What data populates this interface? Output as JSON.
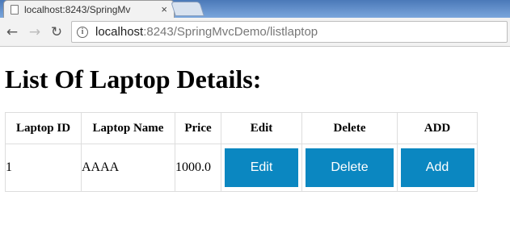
{
  "browser": {
    "tab_title": "localhost:8243/SpringMv",
    "tab_close": "×",
    "url_host": "localhost",
    "url_path": ":8243/SpringMvcDemo/listlaptop"
  },
  "page": {
    "title": "List Of Laptop Details:"
  },
  "table": {
    "headers": [
      "Laptop ID",
      "Laptop Name",
      "Price",
      "Edit",
      "Delete",
      "ADD"
    ],
    "rows": [
      {
        "id": "1",
        "name": "AAAA",
        "price": "1000.0",
        "edit_label": "Edit",
        "delete_label": "Delete",
        "add_label": "Add"
      }
    ]
  },
  "colors": {
    "button_bg": "#0b87c1",
    "border": "#dddddd"
  },
  "icons": {
    "back": "arrow-left-icon",
    "forward": "arrow-right-icon",
    "reload": "reload-icon",
    "info": "info-icon",
    "tab": "file-icon"
  }
}
